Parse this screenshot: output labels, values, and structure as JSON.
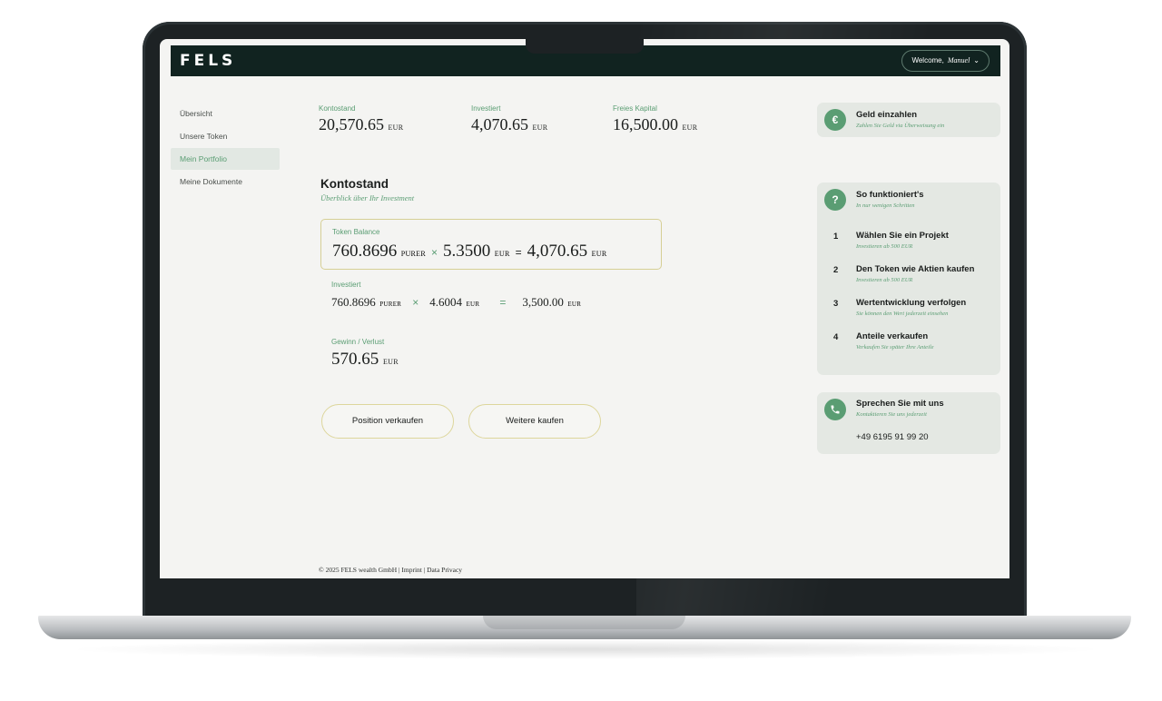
{
  "header": {
    "logo": "FELS",
    "welcome_prefix": "Welcome,",
    "welcome_name": "Manuel",
    "chevron": "⌄"
  },
  "sidebar": {
    "items": [
      {
        "label": "Übersicht"
      },
      {
        "label": "Unsere Token"
      },
      {
        "label": "Mein Portfolio"
      },
      {
        "label": "Meine Dokumente"
      }
    ]
  },
  "stats": [
    {
      "label": "Kontostand",
      "value": "20,570.65",
      "unit": "EUR"
    },
    {
      "label": "Investiert",
      "value": "4,070.65",
      "unit": "EUR"
    },
    {
      "label": "Freies Kapital",
      "value": "16,500.00",
      "unit": "EUR"
    }
  ],
  "section": {
    "title": "Kontostand",
    "subtitle": "Überblick über Ihr Investment"
  },
  "token_balance": {
    "label": "Token Balance",
    "amount": "760.8696",
    "amount_unit": "PURER",
    "times": "×",
    "price": "5.3500",
    "price_unit": "EUR",
    "equals": "=",
    "total": "4,070.65",
    "total_unit": "EUR"
  },
  "invested": {
    "label": "Investiert",
    "amount": "760.8696",
    "amount_unit": "PURER",
    "times": "×",
    "price": "4.6004",
    "price_unit": "EUR",
    "equals": "=",
    "total": "3,500.00",
    "total_unit": "EUR"
  },
  "profit": {
    "label": "Gewinn / Verlust",
    "value": "570.65",
    "unit": "EUR"
  },
  "actions": {
    "sell": "Position verkaufen",
    "buy": "Weitere kaufen"
  },
  "footer": "© 2025 FELS wealth GmbH | Imprint | Data Privacy",
  "deposit": {
    "icon": "€",
    "title": "Geld einzahlen",
    "subtitle": "Zahlen Sie Geld via Überweisung ein"
  },
  "howto": {
    "icon": "?",
    "title": "So funktioniert's",
    "subtitle": "In nur wenigen Schritten",
    "steps": [
      {
        "num": "1",
        "title": "Wählen Sie ein Projekt",
        "sub": "Investieren ab 500 EUR"
      },
      {
        "num": "2",
        "title": "Den Token wie Aktien kaufen",
        "sub": "Investieren ab 500 EUR"
      },
      {
        "num": "3",
        "title": "Wertentwicklung verfolgen",
        "sub": "Sie können den Wert jederzeit einsehen"
      },
      {
        "num": "4",
        "title": "Anteile verkaufen",
        "sub": "Verkaufen Sie später Ihre Anteile"
      }
    ]
  },
  "contact": {
    "title": "Sprechen Sie mit uns",
    "subtitle": "Kontaktieren Sie uns jederzeit",
    "phone": "+49 6195 91 99 20"
  },
  "colors": {
    "brand_dark": "#112320",
    "accent_green": "#5a9d73",
    "gold_border": "#d6cf95"
  }
}
